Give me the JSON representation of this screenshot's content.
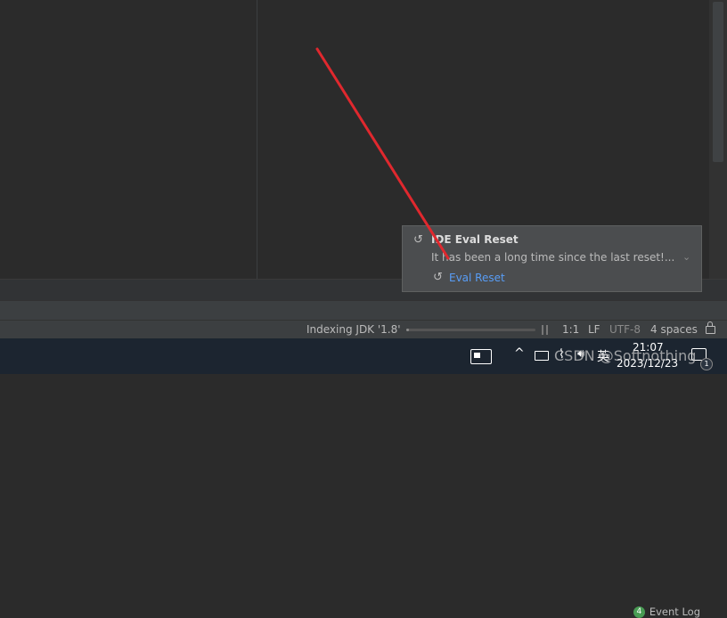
{
  "notification": {
    "title": "IDE Eval Reset",
    "body": "It has been a long time since the last reset!...",
    "action_label": "Eval Reset",
    "icon": "undo-icon",
    "accent": "#589df6"
  },
  "tool_strip": {
    "event_log_count": "4",
    "event_log_label": "Event Log"
  },
  "status_bar": {
    "indexing_text": "Indexing JDK '1.8'",
    "indexing_progress": 0.02,
    "caret_position": "1:1",
    "line_separator": "LF",
    "encoding": "UTF-8",
    "indent": "4 spaces"
  },
  "taskbar": {
    "ime_label": "英",
    "time": "21:07",
    "date": "2023/12/23",
    "notification_count": "1",
    "watermark_text": "CSDN @Softnothing"
  },
  "colors": {
    "editor_bg": "#2b2b2b",
    "status_bg": "#3c3f41",
    "arrow": "#e0282e"
  }
}
